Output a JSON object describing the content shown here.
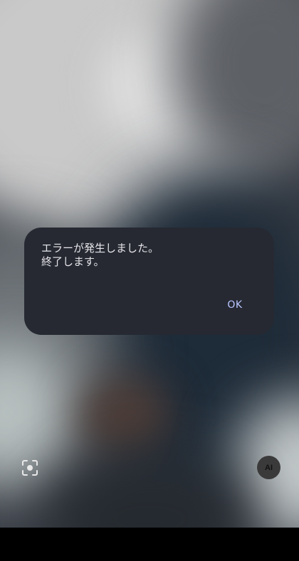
{
  "dialog": {
    "message": "エラーが発生しました。\n終了します。",
    "ok_label": "OK"
  },
  "camera": {
    "lens_icon": "lens-scan-icon",
    "ai_label": "AI"
  },
  "colors": {
    "dialog_bg": "#262932",
    "dialog_text": "#e6e6ea",
    "accent": "#b9c6ff"
  }
}
